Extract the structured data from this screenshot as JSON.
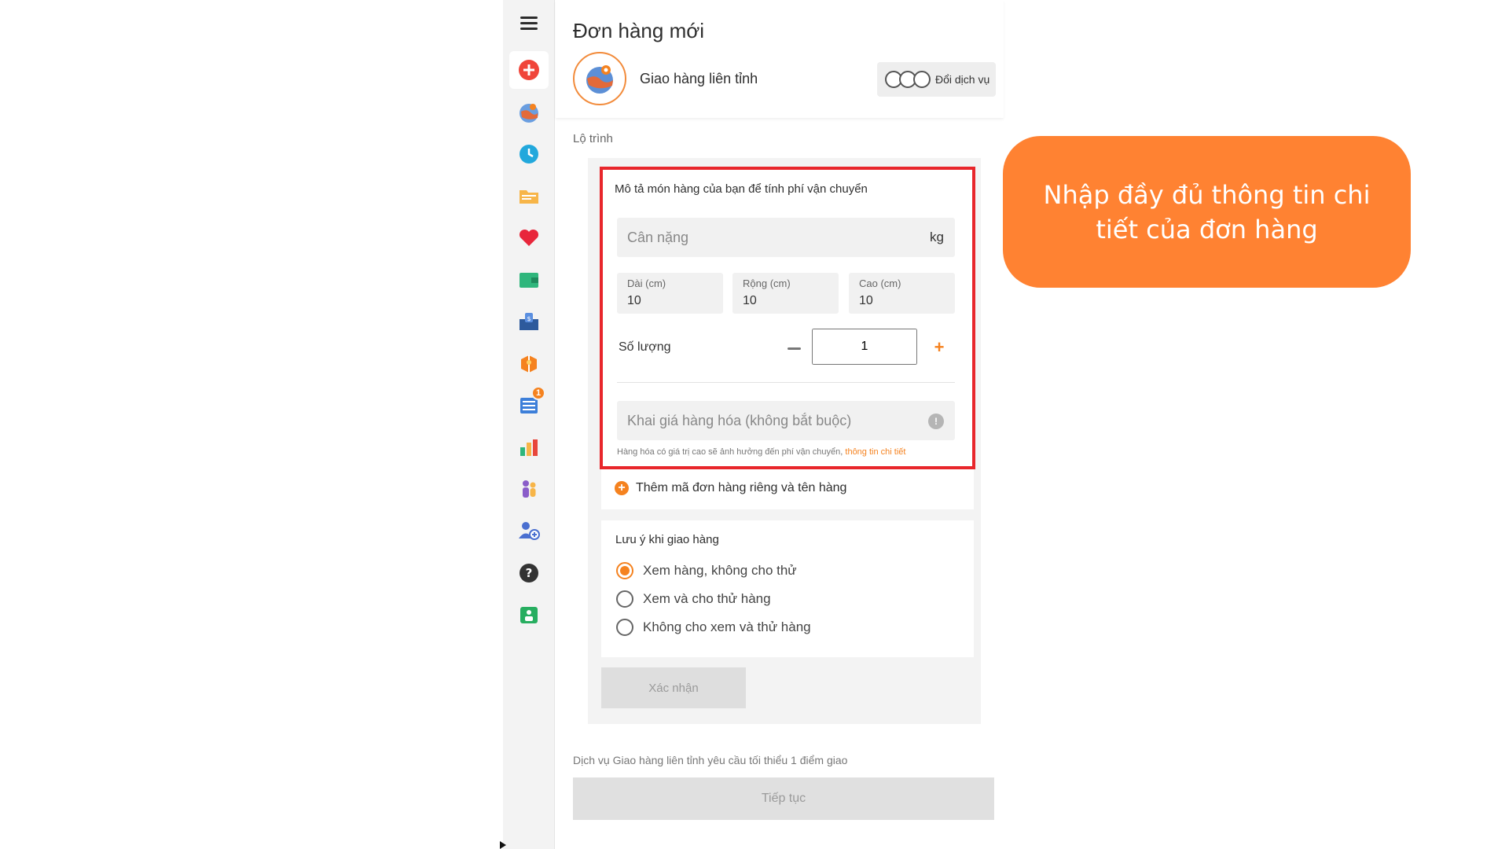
{
  "header": {
    "title": "Đơn hàng mới",
    "service_name": "Giao hàng liên tỉnh",
    "change_service_label": "Đổi dịch vụ"
  },
  "sidebar": {
    "badge_count": "1",
    "items": [
      {
        "name": "create-order-icon",
        "color": "#f0453a"
      },
      {
        "name": "delivery-globe-icon",
        "color": "#5c8fd6"
      },
      {
        "name": "clock-icon",
        "color": "#22a8dc"
      },
      {
        "name": "folder-icon",
        "color": "#f7b548"
      },
      {
        "name": "heart-icon",
        "color": "#e8263b"
      },
      {
        "name": "wallet-icon",
        "color": "#2fb67c"
      },
      {
        "name": "payment-inbox-icon",
        "color": "#2d5a9c"
      },
      {
        "name": "gift-box-icon",
        "color": "#f5821f"
      },
      {
        "name": "report-list-icon",
        "color": "#3d7fd9"
      },
      {
        "name": "bar-chart-icon",
        "color": "#e8463b"
      },
      {
        "name": "people-icon",
        "color": "#8a5cc9"
      },
      {
        "name": "add-contact-icon",
        "color": "#4a6fd0"
      },
      {
        "name": "help-icon",
        "color": "#333333"
      },
      {
        "name": "badge-id-icon",
        "color": "#27ae60"
      }
    ]
  },
  "route_label": "Lộ trình",
  "item": {
    "description": "Mô tả món hàng của bạn để tính phí vận chuyển",
    "weight_placeholder": "Cân nặng",
    "weight_unit": "kg",
    "length_label": "Dài (cm)",
    "length_value": "10",
    "width_label": "Rộng (cm)",
    "width_value": "10",
    "height_label": "Cao (cm)",
    "height_value": "10",
    "quantity_label": "Số lượng",
    "quantity_value": "1",
    "price_placeholder": "Khai giá hàng hóa (không bắt buộc)",
    "price_note": "Hàng hóa có giá trị cao sẽ ảnh hưởng đến phí vận chuyển, ",
    "price_note_link": "thông tin chi tiết",
    "add_code_label": "Thêm mã đơn hàng riêng và tên hàng"
  },
  "delivery_note": {
    "title": "Lưu ý khi giao hàng",
    "options": [
      {
        "label": "Xem hàng, không cho thử",
        "checked": true
      },
      {
        "label": "Xem và cho thử hàng",
        "checked": false
      },
      {
        "label": "Không cho xem và thử hàng",
        "checked": false
      }
    ]
  },
  "confirm_label": "Xác nhận",
  "requirement_note": "Dịch vụ Giao hàng liên tỉnh yêu cầu tối thiểu 1 điểm giao",
  "continue_label": "Tiếp tục",
  "callout": {
    "text": "Nhập đầy đủ thông tin chi tiết của đơn hàng"
  },
  "colors": {
    "accent": "#f5821f",
    "highlight_border": "#e8262b",
    "callout_bg": "#ff8232"
  }
}
